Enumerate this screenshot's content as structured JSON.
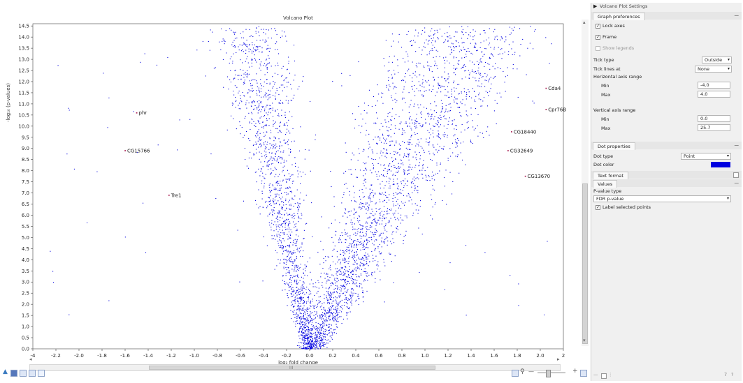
{
  "chart_data": {
    "type": "scatter",
    "title": "Volcano Plot",
    "xlabel": "log₂ fold change",
    "ylabel": "-log₁₀ (p-values)",
    "xlim": [
      -4.0,
      4.0
    ],
    "ylim": [
      0.0,
      14.6
    ],
    "x_ticks": [
      "-4",
      "-2.2",
      "-2.0",
      "-1.8",
      "-1.6",
      "-1.4",
      "-1.2",
      "-1.0",
      "-0.8",
      "-0.6",
      "-0.4",
      "-0.2",
      "0.0",
      "0.2",
      "0.4",
      "0.6",
      "0.8",
      "1.0",
      "1.2",
      "1.4",
      "1.6",
      "1.8",
      "2.0",
      "2"
    ],
    "y_ticks": [
      "0.0",
      "0.5",
      "1.0",
      "1.5",
      "2.0",
      "2.5",
      "3.0",
      "3.5",
      "4.0",
      "4.5",
      "5.0",
      "5.5",
      "6.0",
      "6.5",
      "7.0",
      "7.5",
      "8.0",
      "8.5",
      "9.0",
      "9.5",
      "10.0",
      "10.5",
      "11.0",
      "11.5",
      "12.0",
      "12.5",
      "13.0",
      "13.5",
      "14.0",
      "14.5"
    ],
    "dot_color": "#0000e0",
    "labeled_points": [
      {
        "label": "Cda4",
        "x": 2.05,
        "y": 11.7
      },
      {
        "label": "Cpr76B",
        "x": 2.05,
        "y": 10.75
      },
      {
        "label": "CG18440",
        "x": 1.75,
        "y": 9.75
      },
      {
        "label": "CG32649",
        "x": 1.72,
        "y": 8.9
      },
      {
        "label": "CG13670",
        "x": 1.87,
        "y": 7.75
      },
      {
        "label": "phr",
        "x": -1.5,
        "y": 10.6
      },
      {
        "label": "CG15766",
        "x": -1.6,
        "y": 8.9
      },
      {
        "label": "Tre1",
        "x": -1.22,
        "y": 6.9
      }
    ]
  },
  "settings": {
    "title": "Volcano Plot Settings",
    "graph_preferences": {
      "tab": "Graph preferences",
      "lock_axes": "Lock axes",
      "frame": "Frame",
      "show_legends": "Show legends",
      "tick_type_label": "Tick type",
      "tick_type_value": "Outside",
      "tick_lines_label": "Tick lines at",
      "tick_lines_value": "None",
      "h_range_label": "Horizontal axis range",
      "h_min_label": "Min",
      "h_min_value": "-4.0",
      "h_max_label": "Max",
      "h_max_value": "4.0",
      "v_range_label": "Vertical axis range",
      "v_min_label": "Min",
      "v_min_value": "0.0",
      "v_max_label": "Max",
      "v_max_value": "25.7"
    },
    "dot_properties": {
      "tab": "Dot properties",
      "dot_type_label": "Dot type",
      "dot_type_value": "Point",
      "dot_color_label": "Dot color",
      "dot_color": "#0000e0"
    },
    "text_format": {
      "tab": "Text format"
    },
    "values": {
      "tab": "Values",
      "p_value_type_label": "P-value type",
      "p_value_type_value": "FDR p-value",
      "label_selected": "Label selected points"
    },
    "footer_page": "7"
  }
}
